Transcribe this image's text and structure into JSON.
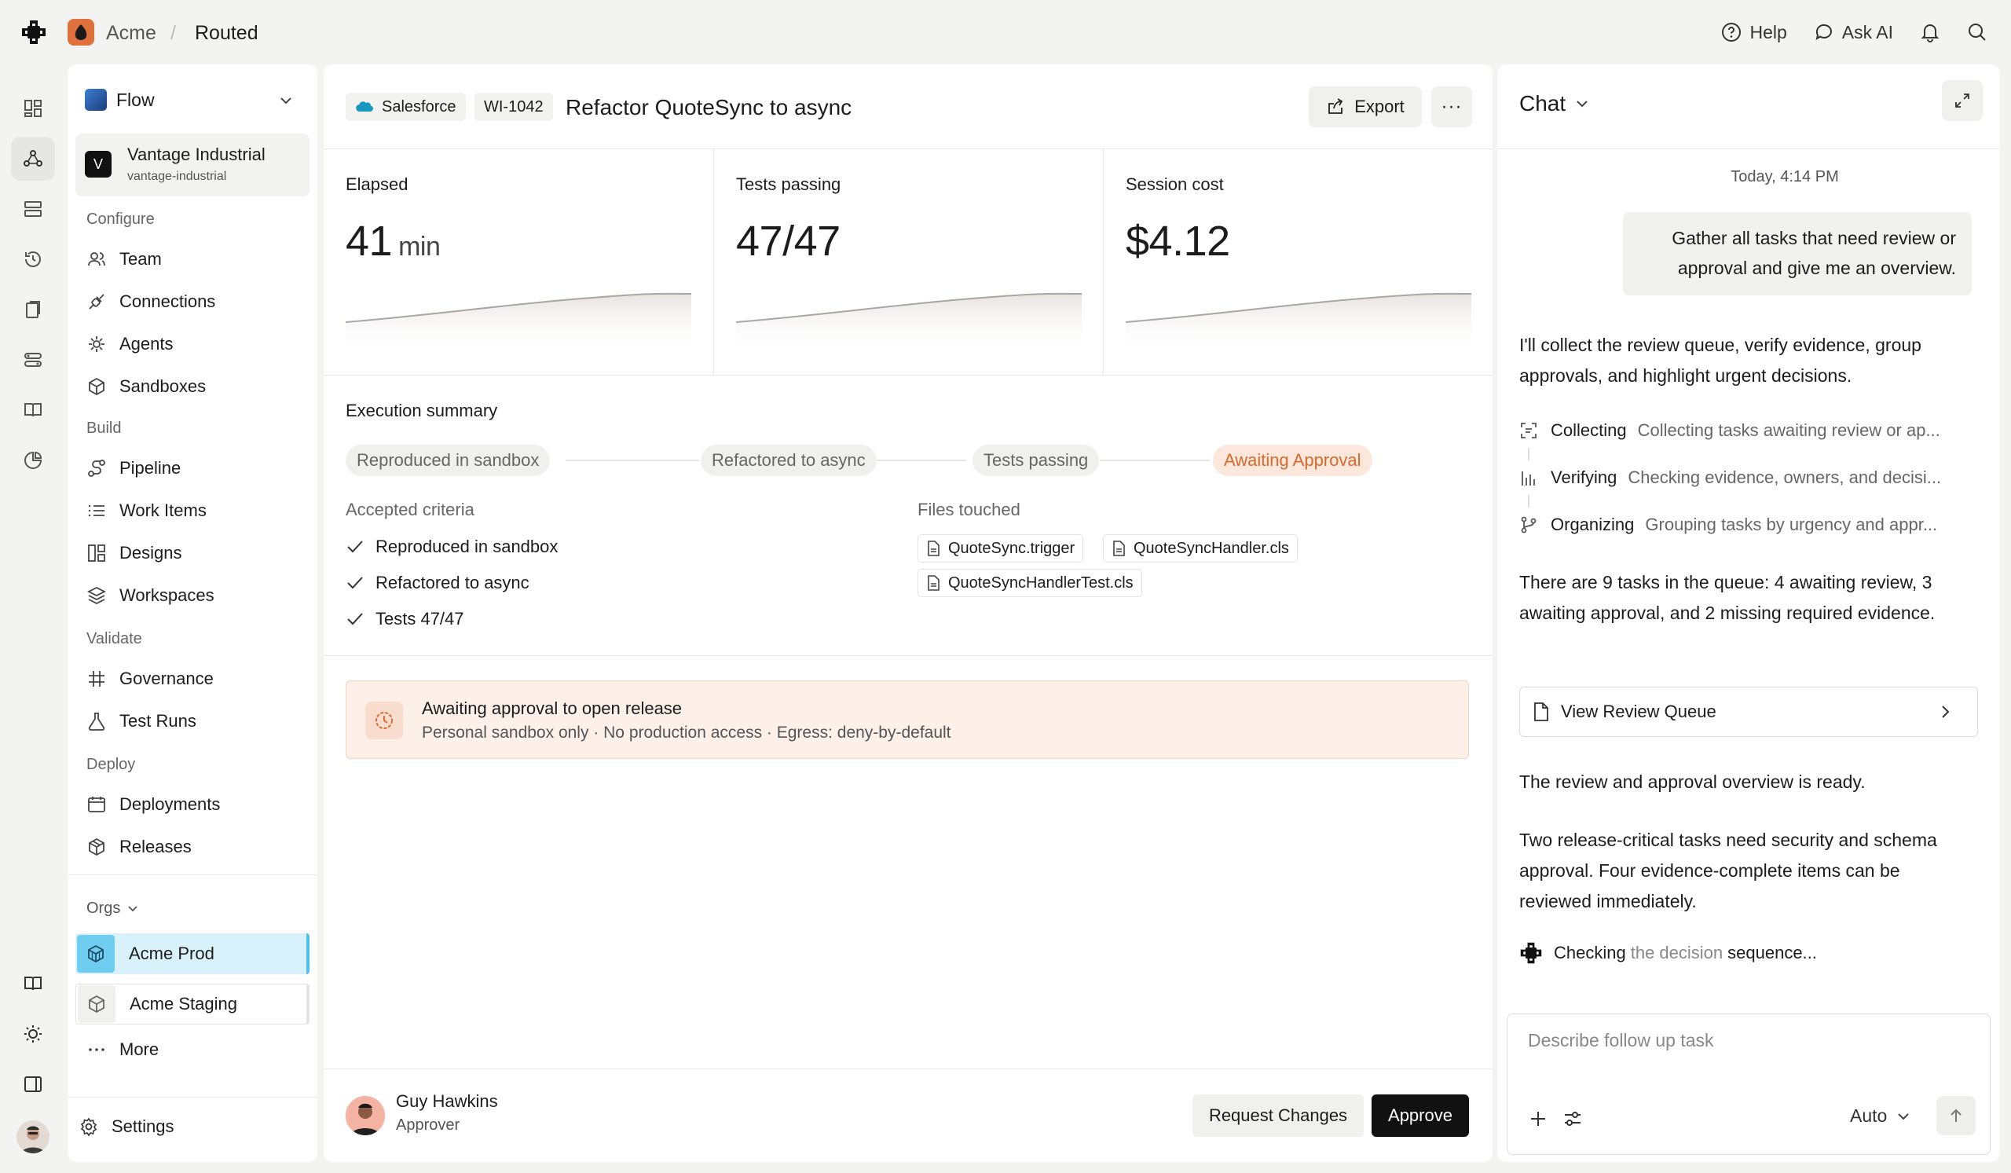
{
  "breadcrumb": {
    "org": "Acme",
    "separator": "/",
    "page": "Routed"
  },
  "topbar": {
    "help": "Help",
    "ask_ai": "Ask AI"
  },
  "nav": {
    "flow_label": "Flow",
    "workspace": {
      "initial": "V",
      "name": "Vantage Industrial",
      "slug": "vantage-industrial"
    },
    "sections": {
      "configure": "Configure",
      "build": "Build",
      "validate": "Validate",
      "deploy": "Deploy"
    },
    "items": {
      "team": "Team",
      "connections": "Connections",
      "agents": "Agents",
      "sandboxes": "Sandboxes",
      "pipeline": "Pipeline",
      "work_items": "Work Items",
      "designs": "Designs",
      "workspaces": "Workspaces",
      "governance": "Governance",
      "test_runs": "Test Runs",
      "deployments": "Deployments",
      "releases": "Releases"
    },
    "orgs_label": "Orgs",
    "orgs": {
      "prod": "Acme Prod",
      "staging": "Acme Staging"
    },
    "more": "More",
    "settings": "Settings"
  },
  "main": {
    "source": "Salesforce",
    "ticket": "WI-1042",
    "title": "Refactor QuoteSync to async",
    "export": "Export",
    "more": "···",
    "metrics": {
      "elapsed": {
        "label": "Elapsed",
        "value": "41",
        "unit": "min"
      },
      "tests": {
        "label": "Tests passing",
        "value": "47/47"
      },
      "cost": {
        "label": "Session cost",
        "value": "$4.12"
      }
    },
    "execution_summary": "Execution summary",
    "steps": [
      "Reproduced in sandbox",
      "Refactored to async",
      "Tests passing",
      "Awaiting Approval"
    ],
    "criteria_label": "Accepted criteria",
    "criteria": [
      "Reproduced in sandbox",
      "Refactored to async",
      "Tests 47/47"
    ],
    "files_label": "Files touched",
    "files": [
      "QuoteSync.trigger",
      "QuoteSyncHandler.cls",
      "QuoteSyncHandlerTest.cls"
    ],
    "alert": {
      "title": "Awaiting approval to open release",
      "subtitle": "Personal sandbox only · No production access · Egress: deny-by-default"
    },
    "approver": {
      "name": "Guy Hawkins",
      "role": "Approver"
    },
    "request_changes": "Request Changes",
    "approve": "Approve"
  },
  "chat": {
    "title": "Chat",
    "timestamp": "Today, 4:14 PM",
    "user_message": "Gather all tasks that need review or approval and give me an overview.",
    "ai_intro": "I'll collect the review queue, verify evidence, group approvals, and highlight urgent decisions.",
    "tools": [
      {
        "name": "Collecting",
        "desc": "Collecting tasks awaiting review or ap..."
      },
      {
        "name": "Verifying",
        "desc": "Checking evidence, owners, and decisi..."
      },
      {
        "name": "Organizing",
        "desc": "Grouping tasks by urgency and appr..."
      }
    ],
    "ai_summary": "There are 9 tasks in the queue: 4 awaiting review, 3 awaiting approval, and 2 missing required evidence.",
    "queue_button": "View Review Queue",
    "ai_ready": "The review and approval overview is ready.",
    "ai_detail": "Two release-critical tasks need security and schema approval. Four evidence-complete items can be reviewed immediately.",
    "checking": {
      "a": "Checking",
      "b": "the decision",
      "c": "sequence..."
    },
    "composer_placeholder": "Describe follow up task",
    "mode": "Auto"
  },
  "colors": {
    "accent_warn": "#d9692c",
    "accent_org": "#4ec0ec",
    "approve_bg": "#111111"
  }
}
